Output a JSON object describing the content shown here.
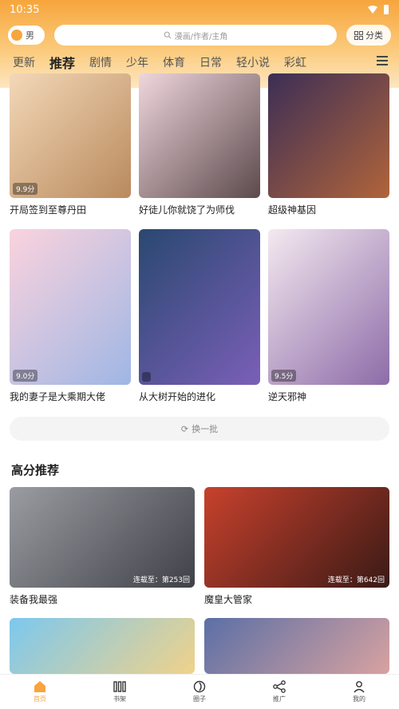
{
  "status": {
    "time": "10:35"
  },
  "header": {
    "gender_label": "男",
    "search_placeholder": "漫画/作者/主角",
    "category_label": "分类"
  },
  "tabs": [
    "更新",
    "推荐",
    "剧情",
    "少年",
    "体育",
    "日常",
    "轻小说",
    "彩虹"
  ],
  "active_tab": 1,
  "row1": [
    {
      "title": "开局签到至尊丹田",
      "score": "9.9分",
      "color": "#e9c6a0"
    },
    {
      "title": "好徒儿你就饶了为师伐",
      "score": "",
      "color": "#c9a8b2"
    },
    {
      "title": "超级神基因",
      "score": "",
      "color": "#7a6aa8"
    }
  ],
  "row2": [
    {
      "title": "我的妻子是大乘期大佬",
      "score": "9.0分",
      "color": "#f2b7c8"
    },
    {
      "title": "从大树开始的进化",
      "score": "",
      "color": "#3f6a8f"
    },
    {
      "title": "逆天邪神",
      "score": "9.5分",
      "color": "#e7d6e8"
    }
  ],
  "refresh_label": "换一批",
  "section_title": "高分推荐",
  "wide": [
    {
      "title": "装备我最强",
      "update": "连载至：第253回",
      "color": "#6b6d73"
    },
    {
      "title": "魔皇大管家",
      "update": "连载至：第642回",
      "color": "#8a2d1f"
    }
  ],
  "wide2_colors": [
    "#5fb7e8",
    "#7b8fc2"
  ],
  "tabbar": [
    "首页",
    "书架",
    "圈子",
    "推广",
    "我的"
  ]
}
